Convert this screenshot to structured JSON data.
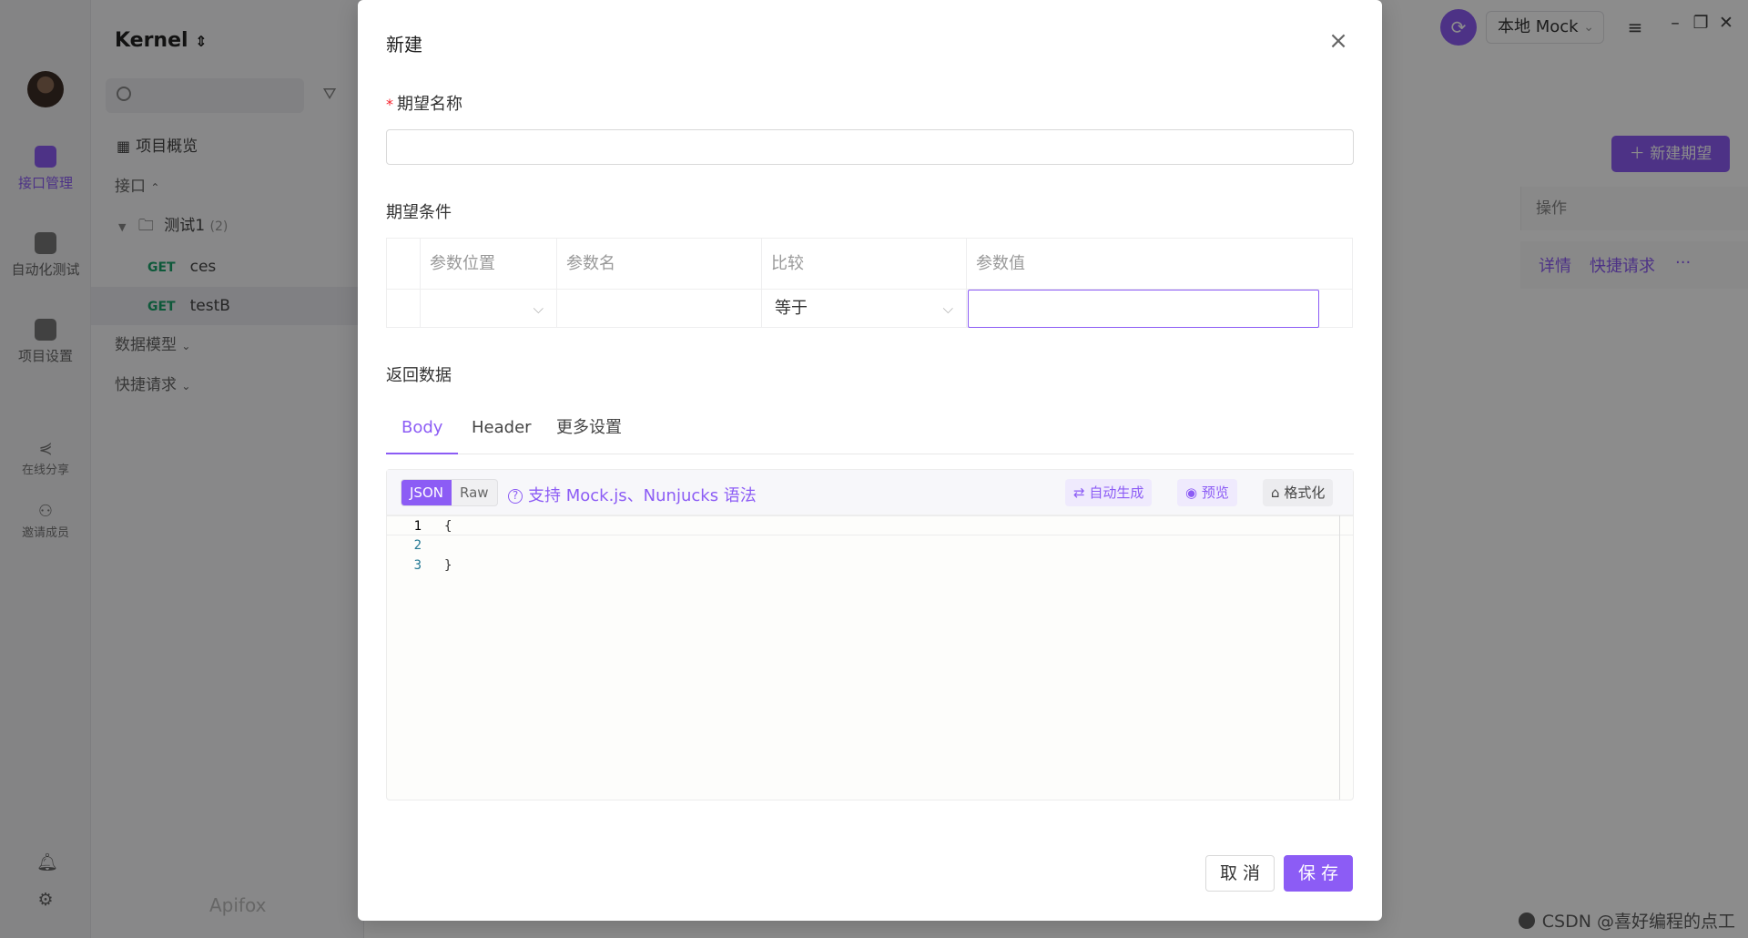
{
  "app": {
    "project_name": "Kernel",
    "project_switch_icon": "chevron-updown-icon",
    "rail": {
      "items": [
        {
          "label": "接口管理",
          "icon": "api-icon"
        },
        {
          "label": "自动化测试",
          "icon": "automation-icon"
        },
        {
          "label": "项目设置",
          "icon": "settings-icon"
        }
      ],
      "small_items": [
        {
          "label": "在线分享",
          "icon": "share-icon"
        },
        {
          "label": "邀请成员",
          "icon": "add-user-icon"
        }
      ]
    },
    "tree": {
      "overview": "项目概览",
      "api_section": "接口",
      "folder_name": "测试1",
      "folder_count": "(2)",
      "apis": [
        {
          "method": "GET",
          "name": "ces"
        },
        {
          "method": "GET",
          "name": "testB"
        }
      ],
      "data_model": "数据模型",
      "quick_request": "快捷请求",
      "brand": "Apifox"
    },
    "topbar": {
      "env": "本地 Mock"
    },
    "main": {
      "new_expectation": "＋ 新建期望",
      "column_op": "操作",
      "row_detail": "详情",
      "row_quick": "快捷请求",
      "row_more": "···"
    },
    "watermark": "CSDN @喜好编程的点工"
  },
  "modal": {
    "title": "新建",
    "name_label": "期望名称",
    "name_required_mark": "*",
    "name_value": "",
    "condition_label": "期望条件",
    "condition_headers": [
      "参数位置",
      "参数名",
      "比较",
      "参数值"
    ],
    "condition_row": {
      "position": "",
      "name": "",
      "compare": "等于",
      "value": ""
    },
    "return_label": "返回数据",
    "tabs": [
      "Body",
      "Header",
      "更多设置"
    ],
    "active_tab": "Body",
    "format_options": [
      "JSON",
      "Raw"
    ],
    "active_format": "JSON",
    "hint": "支持 Mock.js、Nunjucks 语法",
    "tool_buttons": [
      "自动生成",
      "预览",
      "格式化"
    ],
    "editor_lines": [
      {
        "num": "1",
        "code": "{"
      },
      {
        "num": "2",
        "code": ""
      },
      {
        "num": "3",
        "code": "}"
      }
    ],
    "cancel_label": "取 消",
    "save_label": "保 存"
  },
  "colors": {
    "accent": "#8c5cf5",
    "required": "#f5222d",
    "get_method": "#1aa36b"
  }
}
